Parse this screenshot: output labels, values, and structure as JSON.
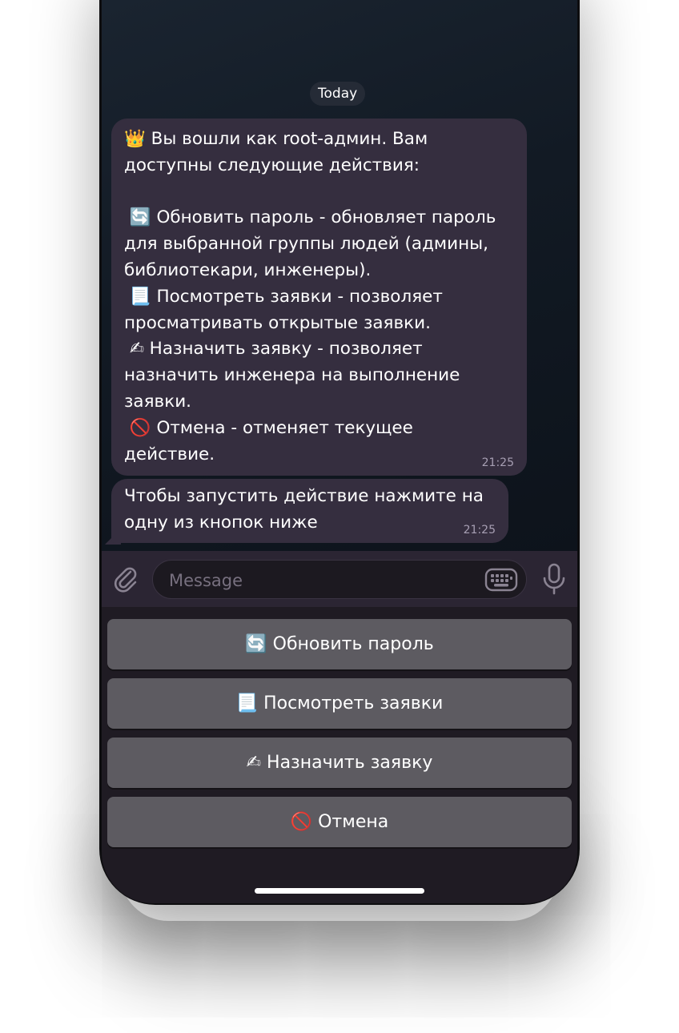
{
  "chat": {
    "date_label": "Today",
    "messages": [
      {
        "lines": [
          "👑 Вы вошли как root-админ. Вам",
          "доступны следующие действия:",
          "",
          " 🔄 Обновить пароль - обновляет пароль",
          "для выбранной группы людей (админы,",
          "библиотекари, инженеры).",
          " 📃 Посмотреть заявки - позволяет",
          "просматривать открытые заявки.",
          " ✍ Назначить заявку - позволяет",
          "назначить инженера на выполнение",
          "заявки.",
          " 🚫 Отмена - отменяет текущее",
          "действие."
        ],
        "time": "21:25"
      },
      {
        "lines": [
          "Чтобы запустить действие нажмите на",
          "одну из кнопок ниже"
        ],
        "time": "21:25"
      }
    ]
  },
  "composer": {
    "placeholder": "Message",
    "value": "",
    "icons": {
      "attach": "paperclip-icon",
      "keyboard": "keyboard-icon",
      "mic": "microphone-icon"
    }
  },
  "reply_keyboard": {
    "buttons": [
      "🔄 Обновить пароль",
      "📃 Посмотреть заявки",
      "✍ Назначить заявку",
      "🚫 Отмена"
    ]
  },
  "colors": {
    "incoming_bubble": "#352e3f",
    "keyboard_button": "#5d5b61",
    "composer_bar": "#2b2533"
  }
}
